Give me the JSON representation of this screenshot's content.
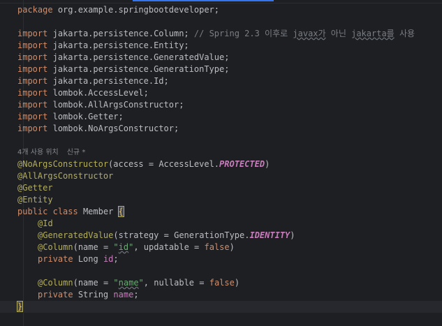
{
  "editor": {
    "package_kw": "package",
    "package_name": "org.example.springbootdeveloper;",
    "imports": [
      {
        "kw": "import",
        "path": "jakarta.persistence.Column;",
        "comment_prefix": "// Spring 2.3 이후로 ",
        "comment_u1": "javax가",
        "comment_mid": " 아닌 ",
        "comment_u2": "jakarta를",
        "comment_suffix": " 사용"
      },
      {
        "kw": "import",
        "path": "jakarta.persistence.Entity;"
      },
      {
        "kw": "import",
        "path": "jakarta.persistence.GeneratedValue;"
      },
      {
        "kw": "import",
        "path": "jakarta.persistence.GenerationType;"
      },
      {
        "kw": "import",
        "path": "jakarta.persistence.Id;"
      },
      {
        "kw": "import",
        "path": "lombok.AccessLevel;"
      },
      {
        "kw": "import",
        "path": "lombok.AllArgsConstructor;"
      },
      {
        "kw": "import",
        "path": "lombok.Getter;"
      },
      {
        "kw": "import",
        "path": "lombok.NoArgsConstructor;"
      }
    ],
    "usage_hint": {
      "usages": "4개 사용 위치",
      "author": "신규 *"
    },
    "class_annotations": {
      "no_args": "@NoArgsConstructor",
      "no_args_open": "(",
      "access_param": "access",
      "eq": " = ",
      "access_type": "AccessLevel.",
      "access_value": "PROTECTED",
      "close": ")",
      "all_args": "@AllArgsConstructor",
      "getter": "@Getter",
      "entity": "@Entity"
    },
    "class_decl": {
      "public_kw": "public",
      "class_kw": "class",
      "name": "Member",
      "open_brace": "{",
      "close_brace": "}"
    },
    "fields": {
      "id_ann": "@Id",
      "gen_ann": "@GeneratedValue",
      "gen_open": "(",
      "strategy_param": "strategy",
      "gen_eq": " = ",
      "gen_type": "GenerationType.",
      "gen_value": "IDENTITY",
      "gen_close": ")",
      "col1_ann": "@Column",
      "col1_open": "(",
      "name_param": "name",
      "col1_eq": " = ",
      "col1_q1": "\"",
      "col1_name": "id",
      "col1_q2": "\"",
      "col1_sep": ", ",
      "updatable_param": "updatable",
      "col1_eq2": " = ",
      "false_kw": "false",
      "col1_close": ")",
      "private_kw": "private",
      "long_type": "Long",
      "id_field": "id",
      "semi": ";",
      "col2_ann": "@Column",
      "col2_open": "(",
      "name_param2": "name",
      "col2_eq": " = ",
      "col2_q1": "\"",
      "col2_name": "name",
      "col2_q2": "\"",
      "col2_sep": ", ",
      "nullable_param": "nullable",
      "col2_eq2": " = ",
      "false_kw2": "false",
      "col2_close": ")",
      "private_kw2": "private",
      "string_type": "String",
      "name_field": "name",
      "semi2": ";"
    }
  },
  "colors": {
    "background": "#1e1f22",
    "keyword": "#cf8e6d",
    "annotation": "#b3ae60",
    "string": "#6aab73",
    "comment": "#7a7e85",
    "constant": "#c77dbb",
    "text": "#bcbec4",
    "tab_indicator": "#3574f0"
  }
}
